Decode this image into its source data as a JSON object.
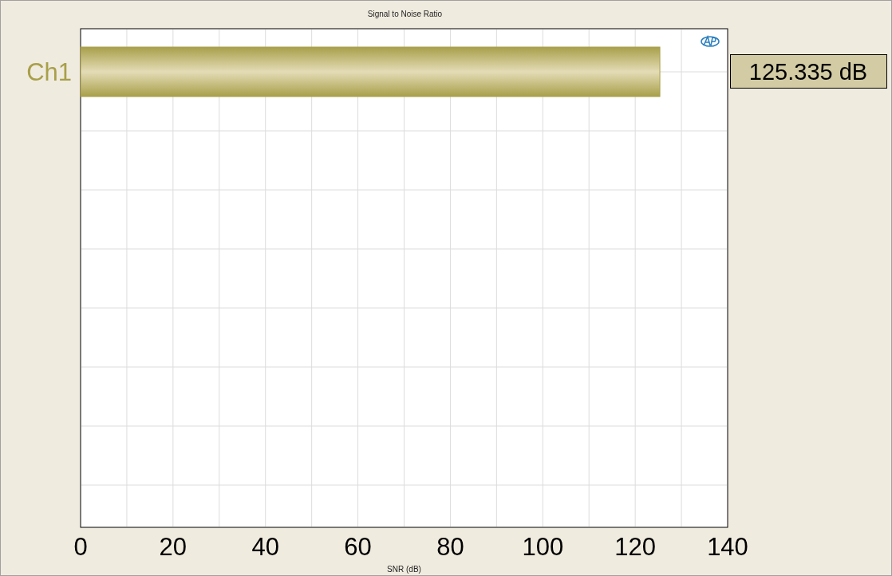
{
  "chart_data": {
    "type": "bar",
    "orientation": "horizontal",
    "title": "Signal to Noise Ratio",
    "xlabel": "SNR (dB)",
    "categories": [
      "Ch1"
    ],
    "grid": true,
    "series": [
      {
        "color": "#a89f4a",
        "values": [
          125.335
        ]
      }
    ],
    "xlim": [
      0,
      140
    ],
    "xticks": [
      0,
      20,
      40,
      60,
      80,
      100,
      120,
      140
    ],
    "value_labels": [
      "125.335 dB"
    ]
  }
}
